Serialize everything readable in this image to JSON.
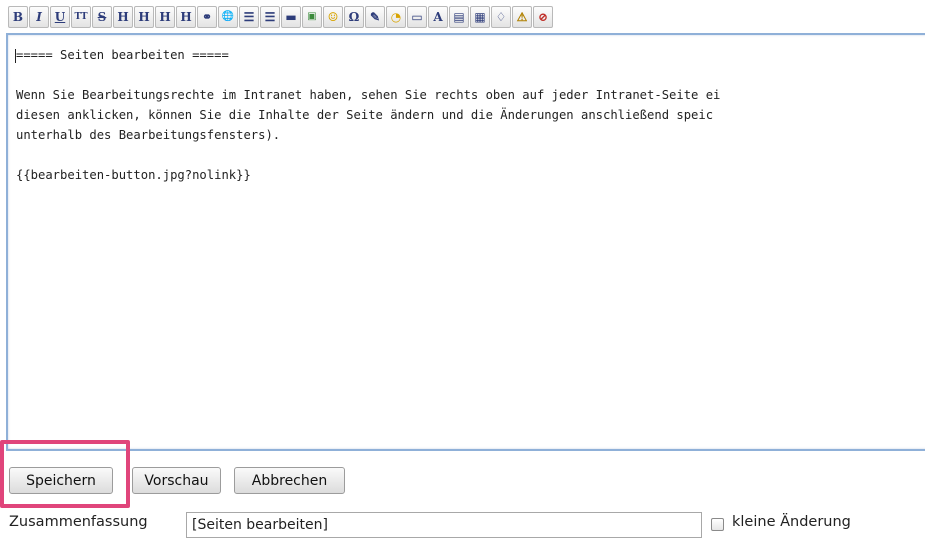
{
  "toolbar": {
    "buttons": [
      {
        "icon": "bold-icon",
        "glyph": "B"
      },
      {
        "icon": "italic-icon",
        "glyph": "I"
      },
      {
        "icon": "underline-icon",
        "glyph": "U"
      },
      {
        "icon": "monospace-icon",
        "glyph": "TT"
      },
      {
        "icon": "strikethrough-icon",
        "glyph": "S"
      },
      {
        "icon": "same-level-heading-icon",
        "glyph": "H"
      },
      {
        "icon": "lower-level-heading-icon",
        "glyph": "H"
      },
      {
        "icon": "higher-level-heading-icon",
        "glyph": "H"
      },
      {
        "icon": "heading-icon",
        "glyph": "H"
      },
      {
        "icon": "internal-link-icon",
        "glyph": "⚭"
      },
      {
        "icon": "external-link-icon",
        "glyph": "🌐"
      },
      {
        "icon": "ordered-list-icon",
        "glyph": "☰"
      },
      {
        "icon": "unordered-list-icon",
        "glyph": "☰"
      },
      {
        "icon": "horizontal-rule-icon",
        "glyph": "▬"
      },
      {
        "icon": "image-icon",
        "glyph": "▣"
      },
      {
        "icon": "smiley-icon",
        "glyph": "☺"
      },
      {
        "icon": "special-chars-icon",
        "glyph": "Ω"
      },
      {
        "icon": "signature-icon",
        "glyph": "✎"
      },
      {
        "icon": "media-icon",
        "glyph": "◔"
      },
      {
        "icon": "wrap-icon",
        "glyph": "▭"
      },
      {
        "icon": "font-icon",
        "glyph": "A"
      },
      {
        "icon": "clapper-icon",
        "glyph": "▤"
      },
      {
        "icon": "note-icon",
        "glyph": "▦"
      },
      {
        "icon": "tip-icon",
        "glyph": "♢"
      },
      {
        "icon": "warning-icon",
        "glyph": "⚠"
      },
      {
        "icon": "stop-icon",
        "glyph": "⊘"
      }
    ]
  },
  "editor": {
    "content": "===== Seiten bearbeiten =====\n\nWenn Sie Bearbeitungsrechte im Intranet haben, sehen Sie rechts oben auf jeder Intranet-Seite ei\ndiesen anklicken, können Sie die Inhalte der Seite ändern und die Änderungen anschließend speic\nunterhalb des Bearbeitungsfensters).\n\n{{bearbeiten-button.jpg?nolink}}"
  },
  "buttons": {
    "save": "Speichern",
    "preview": "Vorschau",
    "cancel": "Abbrechen"
  },
  "summary": {
    "label": "Zusammenfassung",
    "value": "[Seiten bearbeiten]"
  },
  "minor_change": {
    "label": "kleine Änderung",
    "checked": false
  },
  "colors": {
    "highlight": "#e0457b",
    "editor_border": "#8fb0d8"
  }
}
